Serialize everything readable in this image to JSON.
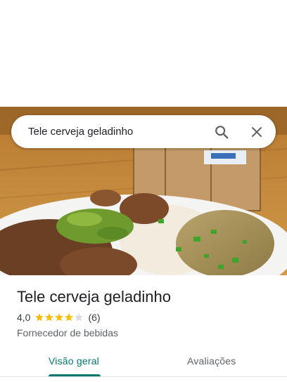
{
  "search": {
    "query": "Tele cerveja geladinho"
  },
  "place": {
    "name": "Tele cerveja geladinho",
    "rating": "4,0",
    "rating_value": 4,
    "rating_max": 5,
    "review_count": "(6)",
    "category": "Fornecedor de bebidas"
  },
  "tabs": [
    {
      "label": "Visão geral",
      "active": true
    },
    {
      "label": "Avaliações",
      "active": false
    }
  ],
  "colors": {
    "accent": "#00796b",
    "star_filled": "#fbbc04",
    "star_empty": "#dadce0"
  },
  "icons": {
    "search": "search-icon",
    "close": "close-icon",
    "star": "star-icon"
  }
}
